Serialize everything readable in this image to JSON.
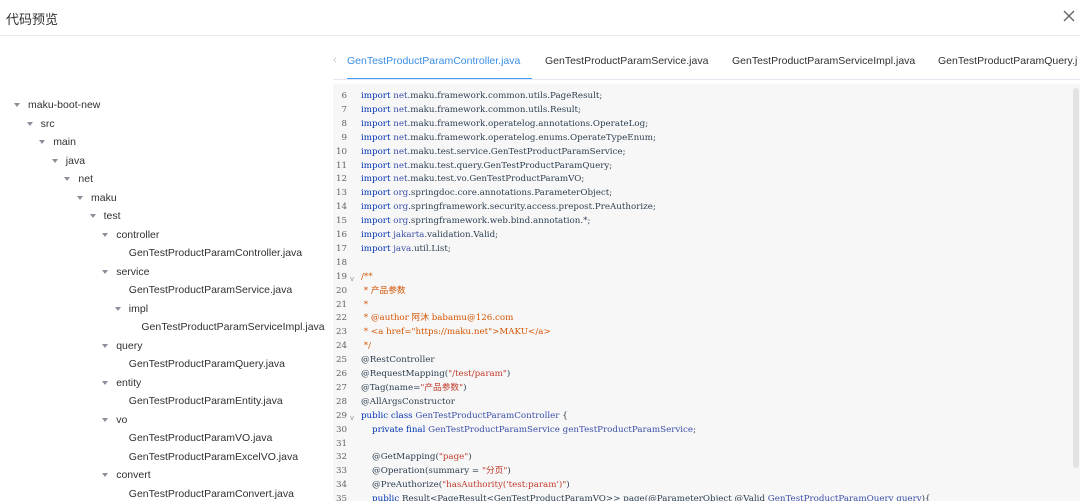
{
  "dialog": {
    "title": "代码预览"
  },
  "icons": {
    "close": "close-icon",
    "caret": "caret-down-icon",
    "tab_prev": "chevron-left-icon",
    "fold": "fold-arrow-icon"
  },
  "colors": {
    "active_tab": "#409eff",
    "code_background": "#f7f7f7",
    "keyword": "#0033b3",
    "comment": "#d35400"
  },
  "tabs": [
    {
      "label": "GenTestProductParamController.java",
      "active": true
    },
    {
      "label": "GenTestProductParamService.java",
      "active": false
    },
    {
      "label": "GenTestProductParamServiceImpl.java",
      "active": false
    },
    {
      "label": "GenTestProductParamQuery.j",
      "active": false
    }
  ],
  "tree": [
    {
      "label": "maku-boot-new",
      "depth": 0,
      "expanded": true
    },
    {
      "label": "src",
      "depth": 1,
      "expanded": true
    },
    {
      "label": "main",
      "depth": 2,
      "expanded": true
    },
    {
      "label": "java",
      "depth": 3,
      "expanded": true
    },
    {
      "label": "net",
      "depth": 4,
      "expanded": true
    },
    {
      "label": "maku",
      "depth": 5,
      "expanded": true
    },
    {
      "label": "test",
      "depth": 6,
      "expanded": true
    },
    {
      "label": "controller",
      "depth": 7,
      "expanded": true
    },
    {
      "label": "GenTestProductParamController.java",
      "depth": 8,
      "expanded": false
    },
    {
      "label": "service",
      "depth": 7,
      "expanded": true
    },
    {
      "label": "GenTestProductParamService.java",
      "depth": 8,
      "expanded": false
    },
    {
      "label": "impl",
      "depth": 8,
      "expanded": true
    },
    {
      "label": "GenTestProductParamServiceImpl.java",
      "depth": 9,
      "expanded": false
    },
    {
      "label": "query",
      "depth": 7,
      "expanded": true
    },
    {
      "label": "GenTestProductParamQuery.java",
      "depth": 8,
      "expanded": false
    },
    {
      "label": "entity",
      "depth": 7,
      "expanded": true
    },
    {
      "label": "GenTestProductParamEntity.java",
      "depth": 8,
      "expanded": false
    },
    {
      "label": "vo",
      "depth": 7,
      "expanded": true
    },
    {
      "label": "GenTestProductParamVO.java",
      "depth": 8,
      "expanded": false
    },
    {
      "label": "GenTestProductParamExcelVO.java",
      "depth": 8,
      "expanded": false
    },
    {
      "label": "convert",
      "depth": 7,
      "expanded": true
    },
    {
      "label": "GenTestProductParamConvert.java",
      "depth": 8,
      "expanded": false
    }
  ],
  "code": [
    {
      "n": "6",
      "parts": [
        [
          "kw",
          "import "
        ],
        [
          "cl",
          "net"
        ],
        [
          "",
          ".maku.framework.common.utils.PageResult;"
        ]
      ]
    },
    {
      "n": "7",
      "parts": [
        [
          "kw",
          "import "
        ],
        [
          "cl",
          "net"
        ],
        [
          "",
          ".maku.framework.common.utils.Result;"
        ]
      ]
    },
    {
      "n": "8",
      "parts": [
        [
          "kw",
          "import "
        ],
        [
          "cl",
          "net"
        ],
        [
          "",
          ".maku.framework.operatelog.annotations.OperateLog;"
        ]
      ]
    },
    {
      "n": "9",
      "parts": [
        [
          "kw",
          "import "
        ],
        [
          "cl",
          "net"
        ],
        [
          "",
          ".maku.framework.operatelog.enums.OperateTypeEnum;"
        ]
      ]
    },
    {
      "n": "10",
      "parts": [
        [
          "kw",
          "import "
        ],
        [
          "cl",
          "net"
        ],
        [
          "",
          ".maku.test.service.GenTestProductParamService;"
        ]
      ]
    },
    {
      "n": "11",
      "parts": [
        [
          "kw",
          "import "
        ],
        [
          "cl",
          "net"
        ],
        [
          "",
          ".maku.test.query.GenTestProductParamQuery;"
        ]
      ]
    },
    {
      "n": "12",
      "parts": [
        [
          "kw",
          "import "
        ],
        [
          "cl",
          "net"
        ],
        [
          "",
          ".maku.test.vo.GenTestProductParamVO;"
        ]
      ]
    },
    {
      "n": "13",
      "parts": [
        [
          "kw",
          "import "
        ],
        [
          "cl",
          "org"
        ],
        [
          "",
          ".springdoc.core.annotations.ParameterObject;"
        ]
      ]
    },
    {
      "n": "14",
      "parts": [
        [
          "kw",
          "import "
        ],
        [
          "cl",
          "org"
        ],
        [
          "",
          ".springframework.security.access.prepost.PreAuthorize;"
        ]
      ]
    },
    {
      "n": "15",
      "parts": [
        [
          "kw",
          "import "
        ],
        [
          "cl",
          "org"
        ],
        [
          "",
          ".springframework.web.bind.annotation.*;"
        ]
      ]
    },
    {
      "n": "16",
      "parts": [
        [
          "kw",
          "import "
        ],
        [
          "cl",
          "jakarta"
        ],
        [
          "",
          ".validation.Valid;"
        ]
      ]
    },
    {
      "n": "17",
      "parts": [
        [
          "kw",
          "import "
        ],
        [
          "cl",
          "java"
        ],
        [
          "",
          ".util.List;"
        ]
      ]
    },
    {
      "n": "18",
      "parts": []
    },
    {
      "n": "19",
      "fold": true,
      "parts": [
        [
          "cm",
          "/**"
        ]
      ]
    },
    {
      "n": "20",
      "parts": [
        [
          "cm",
          " * 产品参数"
        ]
      ]
    },
    {
      "n": "21",
      "parts": [
        [
          "cm",
          " *"
        ]
      ]
    },
    {
      "n": "22",
      "parts": [
        [
          "cm",
          " * @author 阿沐 babamu@126.com"
        ]
      ]
    },
    {
      "n": "23",
      "parts": [
        [
          "cm",
          " * <a href=\"https://maku.net\">MAKU</a>"
        ]
      ]
    },
    {
      "n": "24",
      "parts": [
        [
          "cm",
          " */"
        ]
      ]
    },
    {
      "n": "25",
      "parts": [
        [
          "at",
          "@RestController"
        ]
      ]
    },
    {
      "n": "26",
      "parts": [
        [
          "at",
          "@RequestMapping("
        ],
        [
          "st",
          "\"/test/param\""
        ],
        [
          "at",
          ")"
        ]
      ]
    },
    {
      "n": "27",
      "parts": [
        [
          "at",
          "@Tag(name="
        ],
        [
          "st",
          "\"产品参数\""
        ],
        [
          "at",
          ")"
        ]
      ]
    },
    {
      "n": "28",
      "parts": [
        [
          "at",
          "@AllArgsConstructor"
        ]
      ]
    },
    {
      "n": "29",
      "fold": true,
      "parts": [
        [
          "kw",
          "public class "
        ],
        [
          "cl",
          "GenTestProductParamController"
        ],
        [
          "",
          " {"
        ]
      ]
    },
    {
      "n": "30",
      "parts": [
        [
          "kw",
          "    private final "
        ],
        [
          "cl",
          "GenTestProductParamService genTestProductParamService"
        ],
        [
          "",
          ";"
        ]
      ]
    },
    {
      "n": "31",
      "parts": []
    },
    {
      "n": "32",
      "parts": [
        [
          "at",
          "    @GetMapping("
        ],
        [
          "st",
          "\"page\""
        ],
        [
          "at",
          ")"
        ]
      ]
    },
    {
      "n": "33",
      "parts": [
        [
          "at",
          "    @Operation(summary = "
        ],
        [
          "st",
          "\"分页\""
        ],
        [
          "at",
          ")"
        ]
      ]
    },
    {
      "n": "34",
      "parts": [
        [
          "at",
          "    @PreAuthorize("
        ],
        [
          "st",
          "\"hasAuthority('test:param')\""
        ],
        [
          "at",
          ")"
        ]
      ]
    },
    {
      "n": "35",
      "parts": [
        [
          "kw",
          "    public "
        ],
        [
          "",
          "Result<PageResult<GenTestProductParamVO>> page(@ParameterObject @Valid "
        ],
        [
          "cl",
          "GenTestProductParamQuery query"
        ],
        [
          "",
          "){"
        ]
      ]
    }
  ]
}
